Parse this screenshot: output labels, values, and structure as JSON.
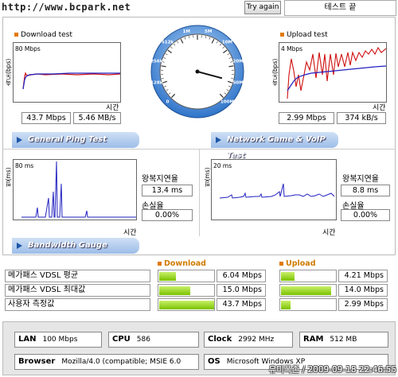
{
  "header": {
    "site_url": "http://www.bcpark.net",
    "try_again": "Try again",
    "test_end": "테스트 끝"
  },
  "download": {
    "title": "Download test",
    "ylabel": "속도(bps)",
    "max_label": "80 Mbps",
    "xlabel": "시간",
    "mbps": "43.7 Mbps",
    "mbs": "5.46 MB/s"
  },
  "upload": {
    "title": "Upload test",
    "ylabel": "속도(bps)",
    "max_label": "4 Mbps",
    "xlabel": "시간",
    "mbps": "2.99 Mbps",
    "kbs": "374 kB/s"
  },
  "gauge": {
    "labels": [
      "0",
      "128k",
      "256k",
      "512k",
      "1M",
      "5M",
      "10M",
      "20M",
      "50M",
      "100M"
    ],
    "needle_value": "50M"
  },
  "ping": {
    "tab": "General Ping Test",
    "ylabel": "핑(ms)",
    "max_label": "80 ms",
    "xlabel": "시간",
    "rtt_label": "왕복지연율",
    "rtt": "13.4 ms",
    "loss_label": "손실율",
    "loss": "0.00%"
  },
  "game": {
    "tab": "Network Game & VoIP Test",
    "ylabel": "핑(ms)",
    "max_label": "20 ms",
    "xlabel": "시간",
    "rtt_label": "왕복지연율",
    "rtt": "8.8 ms",
    "loss_label": "손실율",
    "loss": "0.00%"
  },
  "bandwidth": {
    "tab": "Bandwidth Gauge",
    "download_head": "Download",
    "upload_head": "Upload",
    "rows": [
      {
        "label": "메가패스 VDSL 평균",
        "down": "6.04 Mbps",
        "down_frac": 0.31,
        "up": "4.21 Mbps",
        "up_frac": 0.24
      },
      {
        "label": "메가패스 VDSL 최대값",
        "down": "15.0 Mbps",
        "down_frac": 0.57,
        "up": "14.0 Mbps",
        "up_frac": 0.92
      },
      {
        "label": "사용자 측정값",
        "down": "43.7 Mbps",
        "down_frac": 1.0,
        "up": "2.99 Mbps",
        "up_frac": 0.18
      }
    ]
  },
  "info": {
    "lan_label": "LAN",
    "lan": "100 Mbps",
    "cpu_label": "CPU",
    "cpu": "586",
    "clock_label": "Clock",
    "clock": "2992 MHz",
    "ram_label": "RAM",
    "ram": "512 MB",
    "browser_label": "Browser",
    "browser": "Mozilla/4.0 (compatible; MSIE 6.0",
    "os_label": "OS",
    "os": "Microsoft Windows XP"
  },
  "watermark": "유미폭존 / 2009-09-18 22:46:55",
  "colors": {
    "accent_orange": "#e07a00",
    "bar_green": "#8ccf00",
    "line_blue": "#2020c0",
    "line_red": "#d01010"
  }
}
